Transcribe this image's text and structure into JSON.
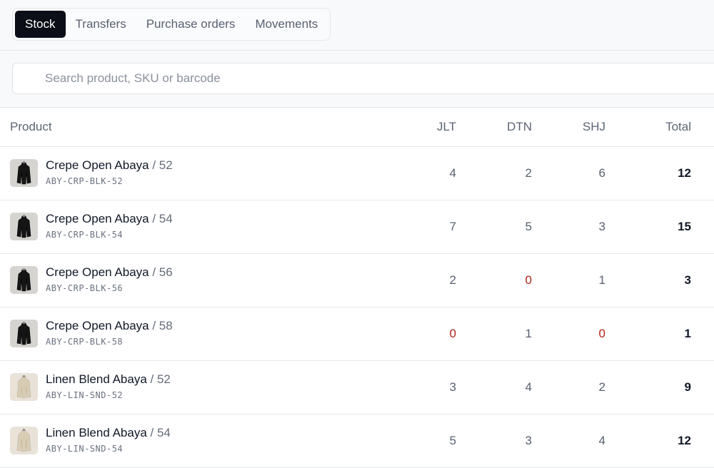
{
  "tabs": [
    {
      "label": "Stock",
      "active": true
    },
    {
      "label": "Transfers",
      "active": false
    },
    {
      "label": "Purchase orders",
      "active": false
    },
    {
      "label": "Movements",
      "active": false
    }
  ],
  "search": {
    "placeholder": "Search product, SKU or barcode",
    "value": ""
  },
  "table": {
    "headers": {
      "product": "Product",
      "jlt": "JLT",
      "dtn": "DTN",
      "shj": "SHJ",
      "total": "Total"
    },
    "rows": [
      {
        "name": "Crepe Open Abaya",
        "size": "/ 52",
        "sku": "ABY-CRP-BLK-52",
        "jlt": "4",
        "dtn": "2",
        "shj": "6",
        "total": "12",
        "color": "black"
      },
      {
        "name": "Crepe Open Abaya",
        "size": "/ 54",
        "sku": "ABY-CRP-BLK-54",
        "jlt": "7",
        "dtn": "5",
        "shj": "3",
        "total": "15",
        "color": "black"
      },
      {
        "name": "Crepe Open Abaya",
        "size": "/ 56",
        "sku": "ABY-CRP-BLK-56",
        "jlt": "2",
        "dtn": "0",
        "shj": "1",
        "total": "3",
        "color": "black"
      },
      {
        "name": "Crepe Open Abaya",
        "size": "/ 58",
        "sku": "ABY-CRP-BLK-58",
        "jlt": "0",
        "dtn": "1",
        "shj": "0",
        "total": "1",
        "color": "black"
      },
      {
        "name": "Linen Blend Abaya",
        "size": "/ 52",
        "sku": "ABY-LIN-SND-52",
        "jlt": "3",
        "dtn": "4",
        "shj": "2",
        "total": "9",
        "color": "sand"
      },
      {
        "name": "Linen Blend Abaya",
        "size": "/ 54",
        "sku": "ABY-LIN-SND-54",
        "jlt": "5",
        "dtn": "3",
        "shj": "4",
        "total": "12",
        "color": "sand"
      }
    ]
  },
  "colors": {
    "zero": "#b42318",
    "active_tab_bg": "#0b0d17",
    "abaya_black": "#151515",
    "abaya_sand": "#d9ccb4"
  }
}
